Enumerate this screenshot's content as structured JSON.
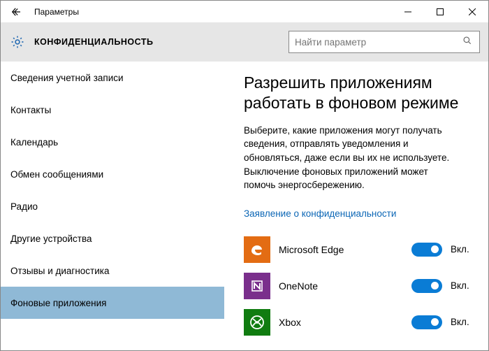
{
  "titlebar": {
    "title": "Параметры"
  },
  "header": {
    "category": "КОНФИДЕНЦИАЛЬНОСТЬ",
    "search_placeholder": "Найти параметр"
  },
  "sidebar": {
    "items": [
      {
        "label": "Сведения учетной записи",
        "active": false
      },
      {
        "label": "Контакты",
        "active": false
      },
      {
        "label": "Календарь",
        "active": false
      },
      {
        "label": "Обмен сообщениями",
        "active": false
      },
      {
        "label": "Радио",
        "active": false
      },
      {
        "label": "Другие устройства",
        "active": false
      },
      {
        "label": "Отзывы и диагностика",
        "active": false
      },
      {
        "label": "Фоновые приложения",
        "active": true
      }
    ]
  },
  "main": {
    "heading": "Разрешить приложениям работать в фоновом режиме",
    "description": "Выберите, какие приложения могут получать сведения, отправлять уведомления и обновляться, даже если вы их не используете. Выключение фоновых приложений может помочь энергосбережению.",
    "privacy_link": "Заявление о конфиденциальности",
    "toggle_on_label": "Вкл.",
    "apps": [
      {
        "name": "Microsoft Edge",
        "icon": "edge",
        "state": "on"
      },
      {
        "name": "OneNote",
        "icon": "onenote",
        "state": "on"
      },
      {
        "name": "Xbox",
        "icon": "xbox",
        "state": "on"
      }
    ]
  }
}
